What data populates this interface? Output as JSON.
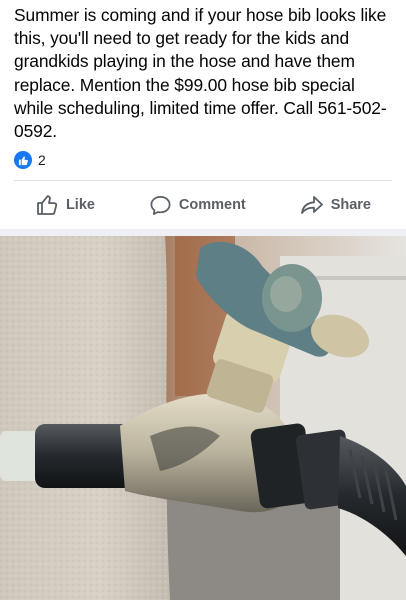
{
  "post": {
    "text": "Summer is coming and if your hose bib looks like this, you'll need to get ready for the kids and grandkids playing in the hose and have them replace. Mention the $99.00 hose bib special while scheduling, limited time offer. Call 561-502-0592."
  },
  "reactions": {
    "icon": "thumbs-up-icon",
    "count": "2",
    "color": "#1877f2"
  },
  "actions": [
    {
      "label": "Like",
      "icon": "thumbs-up-outline-icon"
    },
    {
      "label": "Comment",
      "icon": "speech-bubble-icon"
    },
    {
      "label": "Share",
      "icon": "share-arrow-icon"
    }
  ],
  "photo": {
    "subject": "corroded-hose-bib-image"
  }
}
